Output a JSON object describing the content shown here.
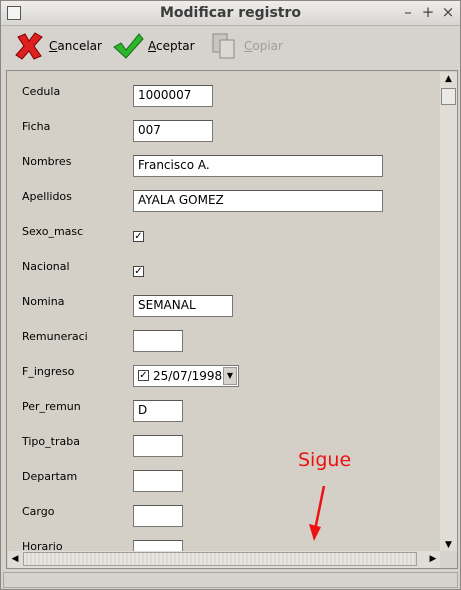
{
  "window": {
    "title": "Modificar registro"
  },
  "toolbar": {
    "cancel": {
      "accel": "C",
      "rest": "ancelar"
    },
    "accept": {
      "accel": "A",
      "rest": "ceptar"
    },
    "copy": {
      "accel": "C",
      "rest": "opiar"
    }
  },
  "fields": {
    "cedula": {
      "label": "Cedula",
      "value": "1000007"
    },
    "ficha": {
      "label": "Ficha",
      "value": "007"
    },
    "nombres": {
      "label": "Nombres",
      "value": "Francisco A."
    },
    "apellidos": {
      "label": "Apellidos",
      "value": "AYALA GOMEZ"
    },
    "sexo_masc": {
      "label": "Sexo_masc",
      "checked": true,
      "mark": "✓"
    },
    "nacional": {
      "label": "Nacional",
      "checked": true,
      "mark": "✓"
    },
    "nomina": {
      "label": "Nomina",
      "value": "SEMANAL"
    },
    "remuneraci": {
      "label": "Remuneraci",
      "value": ""
    },
    "f_ingreso": {
      "label": "F_ingreso",
      "value": "25/07/1998",
      "mark": "✓"
    },
    "per_remun": {
      "label": "Per_remun",
      "value": "D"
    },
    "tipo_traba": {
      "label": "Tipo_traba",
      "value": ""
    },
    "departam": {
      "label": "Departam",
      "value": ""
    },
    "cargo": {
      "label": "Cargo",
      "value": ""
    },
    "horario": {
      "label": "Horario",
      "value": ""
    }
  },
  "annotation": {
    "text": "Sigue",
    "color": "#ee1111"
  },
  "colors": {
    "window_bg": "#d6d3ce",
    "panel_bg": "#d4d0c8"
  }
}
